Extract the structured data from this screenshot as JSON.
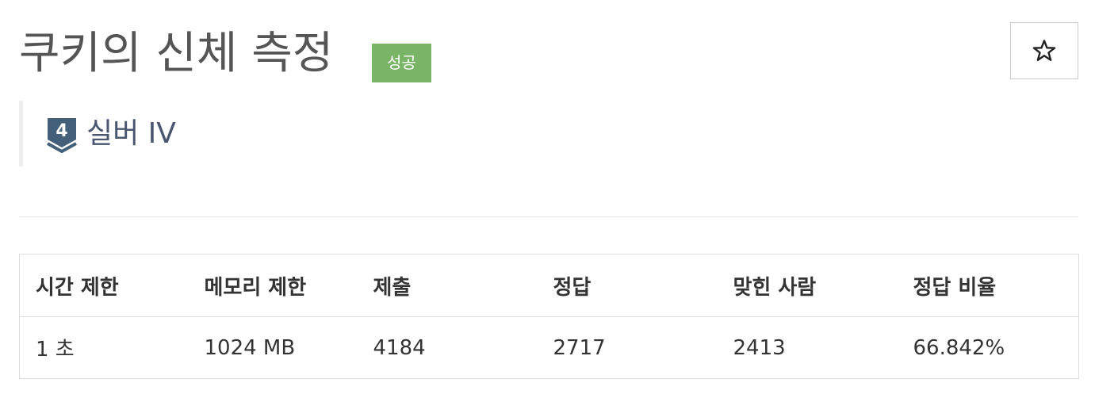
{
  "problem": {
    "title": "쿠키의 신체 측정",
    "status_badge": "성공"
  },
  "favorite": {
    "icon": "star-outline-icon"
  },
  "tier": {
    "icon": "silver-tier-badge-icon",
    "level": "4",
    "label": "실버 IV",
    "color": "#435f7a"
  },
  "info_table": {
    "headers": [
      "시간 제한",
      "메모리 제한",
      "제출",
      "정답",
      "맞힌 사람",
      "정답 비율"
    ],
    "values": [
      "1 초",
      "1024 MB",
      "4184",
      "2717",
      "2413",
      "66.842%"
    ]
  },
  "colors": {
    "badge_success": "#7ab567",
    "title": "#555555",
    "border": "#dddddd"
  }
}
